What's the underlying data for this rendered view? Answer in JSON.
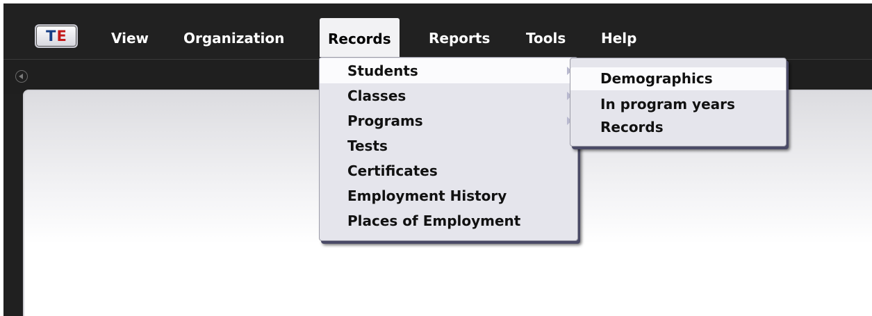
{
  "logo": {
    "letter1": "T",
    "letter2": "E"
  },
  "menubar": {
    "items": [
      {
        "label": "View"
      },
      {
        "label": "Organization"
      },
      {
        "label": "Records"
      },
      {
        "label": "Reports"
      },
      {
        "label": "Tools"
      },
      {
        "label": "Help"
      }
    ],
    "active": "Records"
  },
  "records_menu": {
    "items": [
      {
        "label": "Students",
        "has_submenu": true
      },
      {
        "label": "Classes",
        "has_submenu": true
      },
      {
        "label": "Programs",
        "has_submenu": true
      },
      {
        "label": "Tests",
        "has_submenu": false
      },
      {
        "label": "Certificates",
        "has_submenu": false
      },
      {
        "label": "Employment History",
        "has_submenu": false
      },
      {
        "label": "Places of Employment",
        "has_submenu": false
      }
    ],
    "highlighted": "Students"
  },
  "students_submenu": {
    "items": [
      {
        "label": "Demographics"
      },
      {
        "label": "In program years"
      },
      {
        "label": "Records"
      }
    ],
    "highlighted": "Demographics"
  },
  "colors": {
    "menubar_bg": "#212121",
    "menu_bg": "#e5e5ec",
    "highlight_bg": "#fbfbfd",
    "logo_blue": "#163d85",
    "logo_red": "#c41a1a"
  }
}
